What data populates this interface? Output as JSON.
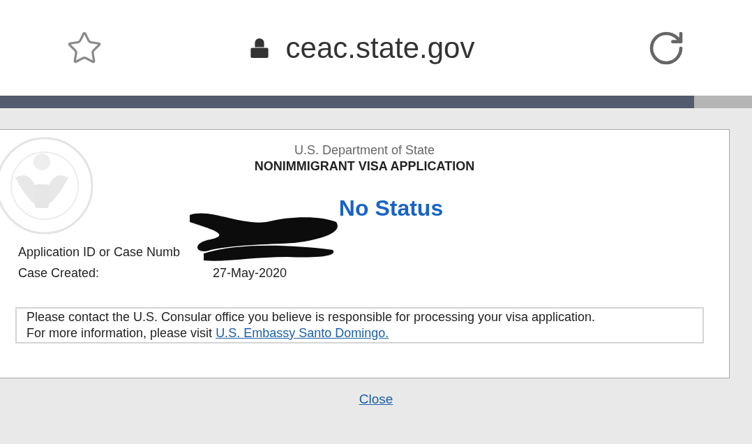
{
  "browser": {
    "url": "ceac.state.gov"
  },
  "dialog": {
    "agency": "U.S. Department of State",
    "form": "NONIMMIGRANT VISA APPLICATION",
    "status": "No Status",
    "fields": [
      {
        "label": "Application ID or Case Numb",
        "redacted": true
      },
      {
        "label": "Case Created:",
        "value": "27-May-2020",
        "redacted": false
      }
    ],
    "notice": {
      "text": "Please contact the U.S. Consular office you believe is responsible for processing your visa application.",
      "more": "For more information, please visit",
      "link": "U.S. Embassy Santo Domingo."
    },
    "close": "Close"
  }
}
